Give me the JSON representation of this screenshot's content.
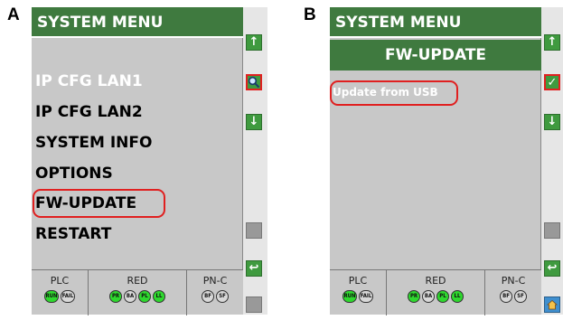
{
  "panels": {
    "a_label": "A",
    "b_label": "B"
  },
  "screen_a": {
    "title": "SYSTEM MENU",
    "menu_items": [
      "IP CFG LAN1",
      "IP CFG LAN2",
      "SYSTEM INFO",
      "OPTIONS",
      "FW-UPDATE",
      "RESTART"
    ],
    "selected_item": "IP CFG LAN1",
    "highlighted_item": "FW-UPDATE",
    "sidebar": {
      "up_icon": "↑",
      "search_icon": "search",
      "down_icon": "↓",
      "return_icon": "↩"
    }
  },
  "screen_b": {
    "title": "SYSTEM MENU",
    "subtitle": "FW-UPDATE",
    "option": "Update from USB",
    "sidebar": {
      "up_icon": "↑",
      "check_icon": "✓",
      "down_icon": "↓",
      "return_icon": "↩"
    }
  },
  "status": {
    "groups": [
      {
        "label": "PLC",
        "leds": [
          {
            "text": "RUN",
            "on": true
          },
          {
            "text": "FAIL",
            "on": false
          }
        ]
      },
      {
        "label": "RED",
        "leds": [
          {
            "text": "PR",
            "on": true
          },
          {
            "text": "BA",
            "on": false
          },
          {
            "text": "PL",
            "on": true
          },
          {
            "text": "LL",
            "on": true
          }
        ]
      },
      {
        "label": "PN-C",
        "leds": [
          {
            "text": "BF",
            "on": false
          },
          {
            "text": "SF",
            "on": false
          }
        ]
      }
    ]
  },
  "colors": {
    "title_green": "#3f7a3f",
    "lcd_gray": "#c8c8c8",
    "highlight_red": "#e02020",
    "led_green": "#2ed82e"
  }
}
